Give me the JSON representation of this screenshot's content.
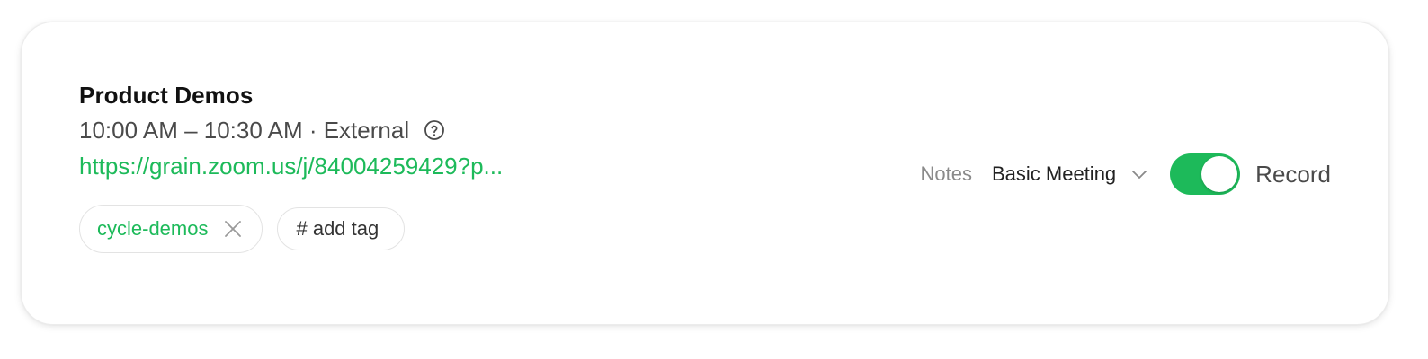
{
  "meeting": {
    "title": "Product Demos",
    "time_range": "10:00 AM – 10:30 AM · External",
    "link_text": "https://grain.zoom.us/j/84004259429?p...",
    "tags": [
      "cycle-demos"
    ],
    "add_tag_label": "# add tag"
  },
  "controls": {
    "notes_label": "Notes",
    "template_value": "Basic Meeting",
    "record_label": "Record",
    "record_enabled": true
  },
  "icons": {
    "help": "help-circle-icon",
    "remove_tag": "close-icon",
    "dropdown": "chevron-down-icon"
  },
  "colors": {
    "accent": "#1dba5a",
    "text_primary": "#111111",
    "text_secondary": "#4a4a4a",
    "text_muted": "#8a8a8a",
    "border": "#e3e3e3"
  }
}
